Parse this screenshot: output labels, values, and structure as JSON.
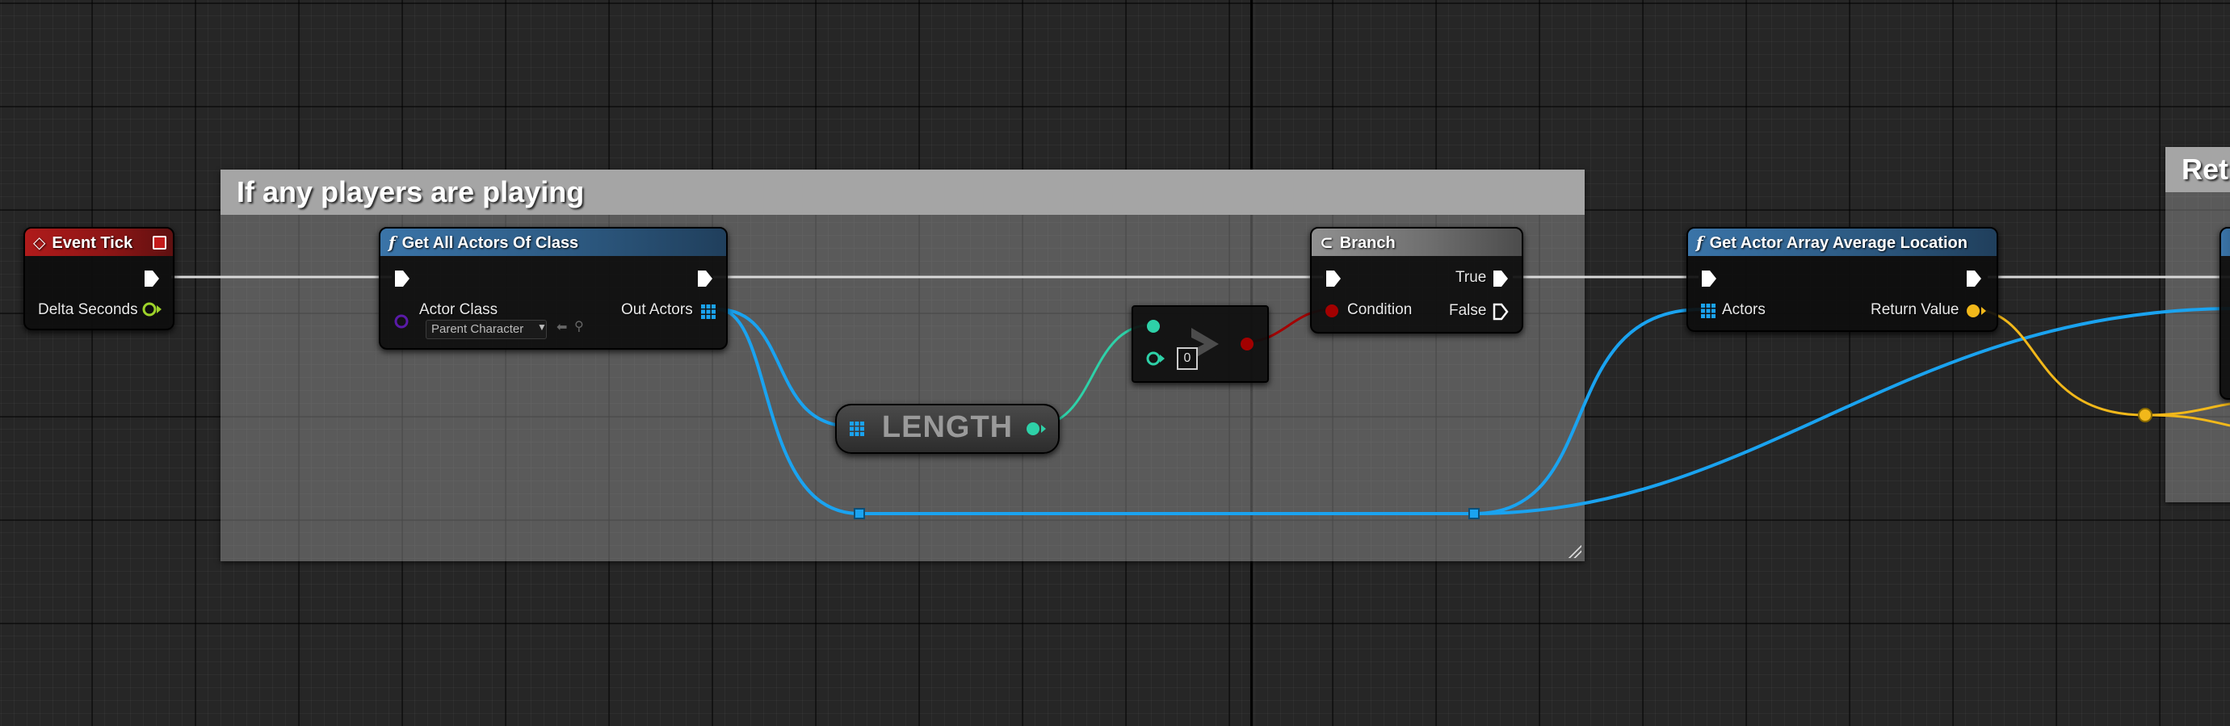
{
  "graph": {
    "comment_main": "If any players are playing",
    "comment_right": "Ret"
  },
  "nodes": {
    "event_tick": {
      "title": "Event Tick",
      "output_delta": "Delta Seconds"
    },
    "get_all_actors": {
      "title": "Get All Actors Of Class",
      "input_actor_class": "Actor Class",
      "actor_class_value": "Parent Character",
      "output_out_actors": "Out Actors"
    },
    "length": {
      "title": "LENGTH"
    },
    "greater_than": {
      "literal_b": "0"
    },
    "branch": {
      "title": "Branch",
      "input_condition": "Condition",
      "output_true": "True",
      "output_false": "False"
    },
    "get_average_location": {
      "title": "Get Actor Array Average Location",
      "input_actors": "Actors",
      "output_return": "Return Value"
    }
  },
  "colors": {
    "exec": "#ffffff",
    "array_object": "#1aa3f0",
    "integer": "#2ed1a8",
    "boolean": "#a30000",
    "vector": "#f2b81a",
    "float": "#9ed32a",
    "class": "#5a1aa8",
    "event_header": "#b01b1b",
    "function_header": "#3a74a8"
  }
}
